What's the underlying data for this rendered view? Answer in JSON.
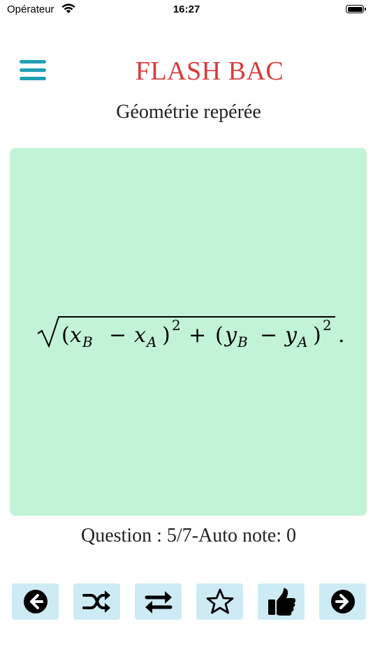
{
  "status_bar": {
    "carrier": "Opérateur",
    "time": "16:27"
  },
  "header": {
    "app_title": "FLASH BAC",
    "chapter": "Géométrie repérée"
  },
  "card": {
    "formula": {
      "x_b": "x",
      "x_b_sub": "B",
      "x_a": "x",
      "x_a_sub": "A",
      "y_b": "y",
      "y_b_sub": "B",
      "y_a": "y",
      "y_a_sub": "A",
      "exponent": "2"
    }
  },
  "footer": {
    "question_status": "Question : 5/7-Auto note: 0"
  },
  "toolbar": {
    "icons": [
      "arrow-left-icon",
      "shuffle-icon",
      "swap-icon",
      "star-icon",
      "thumbs-up-icon",
      "arrow-right-icon"
    ]
  },
  "colors": {
    "accent": "#1f9fb8",
    "title": "#d93a3a",
    "card_bg": "#c3f3d6",
    "button_bg": "#cdebf5"
  }
}
